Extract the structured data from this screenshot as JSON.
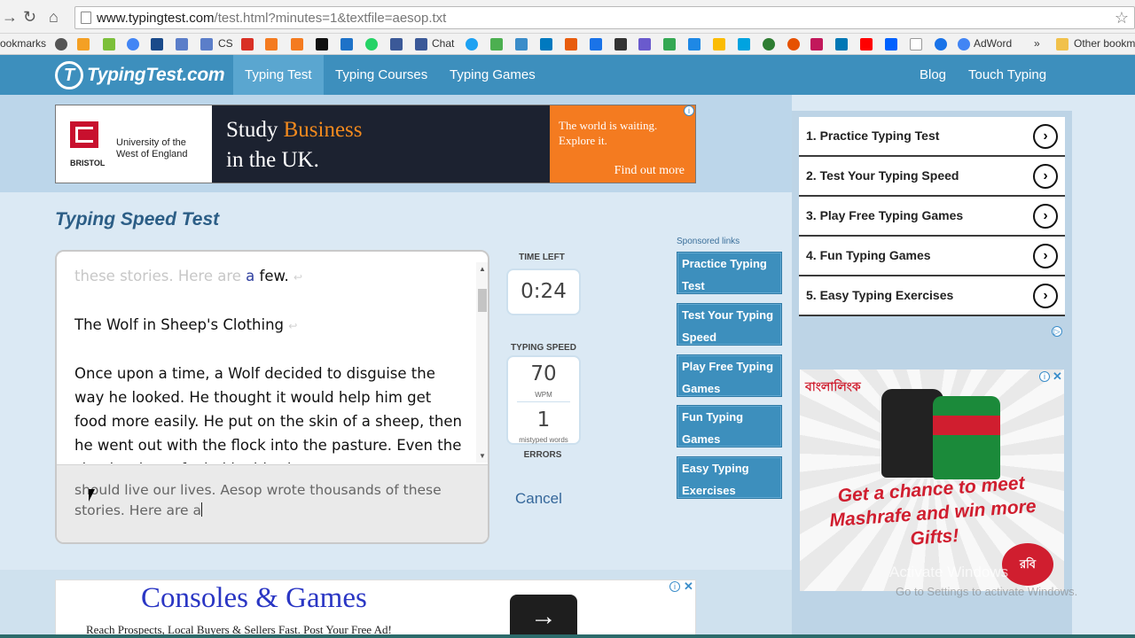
{
  "browser": {
    "url_host": "www.typingtest.com",
    "url_path": "/test.html?minutes=1&textfile=aesop.txt",
    "bookmarks": [
      "ookmarks",
      "CS",
      "Chat",
      "AdWord",
      "»",
      "Other bookm"
    ]
  },
  "site": {
    "logo_text": "TypingTest.com",
    "logo_mark": "T",
    "nav": [
      "Typing Test",
      "Typing Courses",
      "Typing Games"
    ],
    "nav_right": [
      "Blog",
      "Touch Typing"
    ]
  },
  "ad_top": {
    "org_line1": "University of the",
    "org_line2": "West of England",
    "org_short": "BRISTOL",
    "headline_a": "Study ",
    "headline_b": "Business",
    "headline_c": "in the UK.",
    "side_line1": "The world is waiting.",
    "side_line2": "Explore it.",
    "cta": "Find out more"
  },
  "test": {
    "title": "Typing Speed Test",
    "passage": {
      "line1_done": "these stories. Here are ",
      "line1_current": "a",
      "line1_rest": " few.",
      "para2": "The Wolf in Sheep's Clothing",
      "para3": "Once upon a time, a Wolf decided to disguise the way he looked. He thought it would help him get food more easily. He put on the skin of a sheep, then he went out with the flock into the pasture. Even the shepherd was fooled by his clever"
    },
    "input_text": "should live our lives. Aesop wrote thousands of these stories. Here are a",
    "time_left_label": "TIME LEFT",
    "time_left": "0:24",
    "speed_label": "TYPING SPEED",
    "wpm": "70",
    "wpm_unit": "WPM",
    "errors": "1",
    "errors_unit": "mistyped words",
    "errors_label": "ERRORS",
    "cancel": "Cancel"
  },
  "sponsored": {
    "label": "Sponsored links",
    "links": [
      "Practice Typing Test",
      "Test Your Typing Speed",
      "Play Free Typing Games",
      "Fun Typing Games",
      "Easy Typing Exercises"
    ]
  },
  "practice_list": [
    "1. Practice Typing Test",
    "2. Test Your Typing Speed",
    "3. Play Free Typing Games",
    "4. Fun Typing Games",
    "5. Easy Typing Exercises"
  ],
  "ad_right": {
    "brand": "বাংলালিংক",
    "text": "Get a chance to meet Mashrafe and win more Gifts!",
    "logo": "রবি"
  },
  "ad_bottom": {
    "title": "Consoles & Games",
    "subtitle": "Reach Prospects, Local Buyers & Sellers Fast. Post Your Free Ad!",
    "button": "→"
  },
  "watermark": {
    "line1": "Activate Windows",
    "line2": "Go to Settings to activate Windows."
  },
  "colors": {
    "header": "#3d8fbd",
    "accent_link": "#35679a",
    "ad_orange": "#f47b20"
  }
}
